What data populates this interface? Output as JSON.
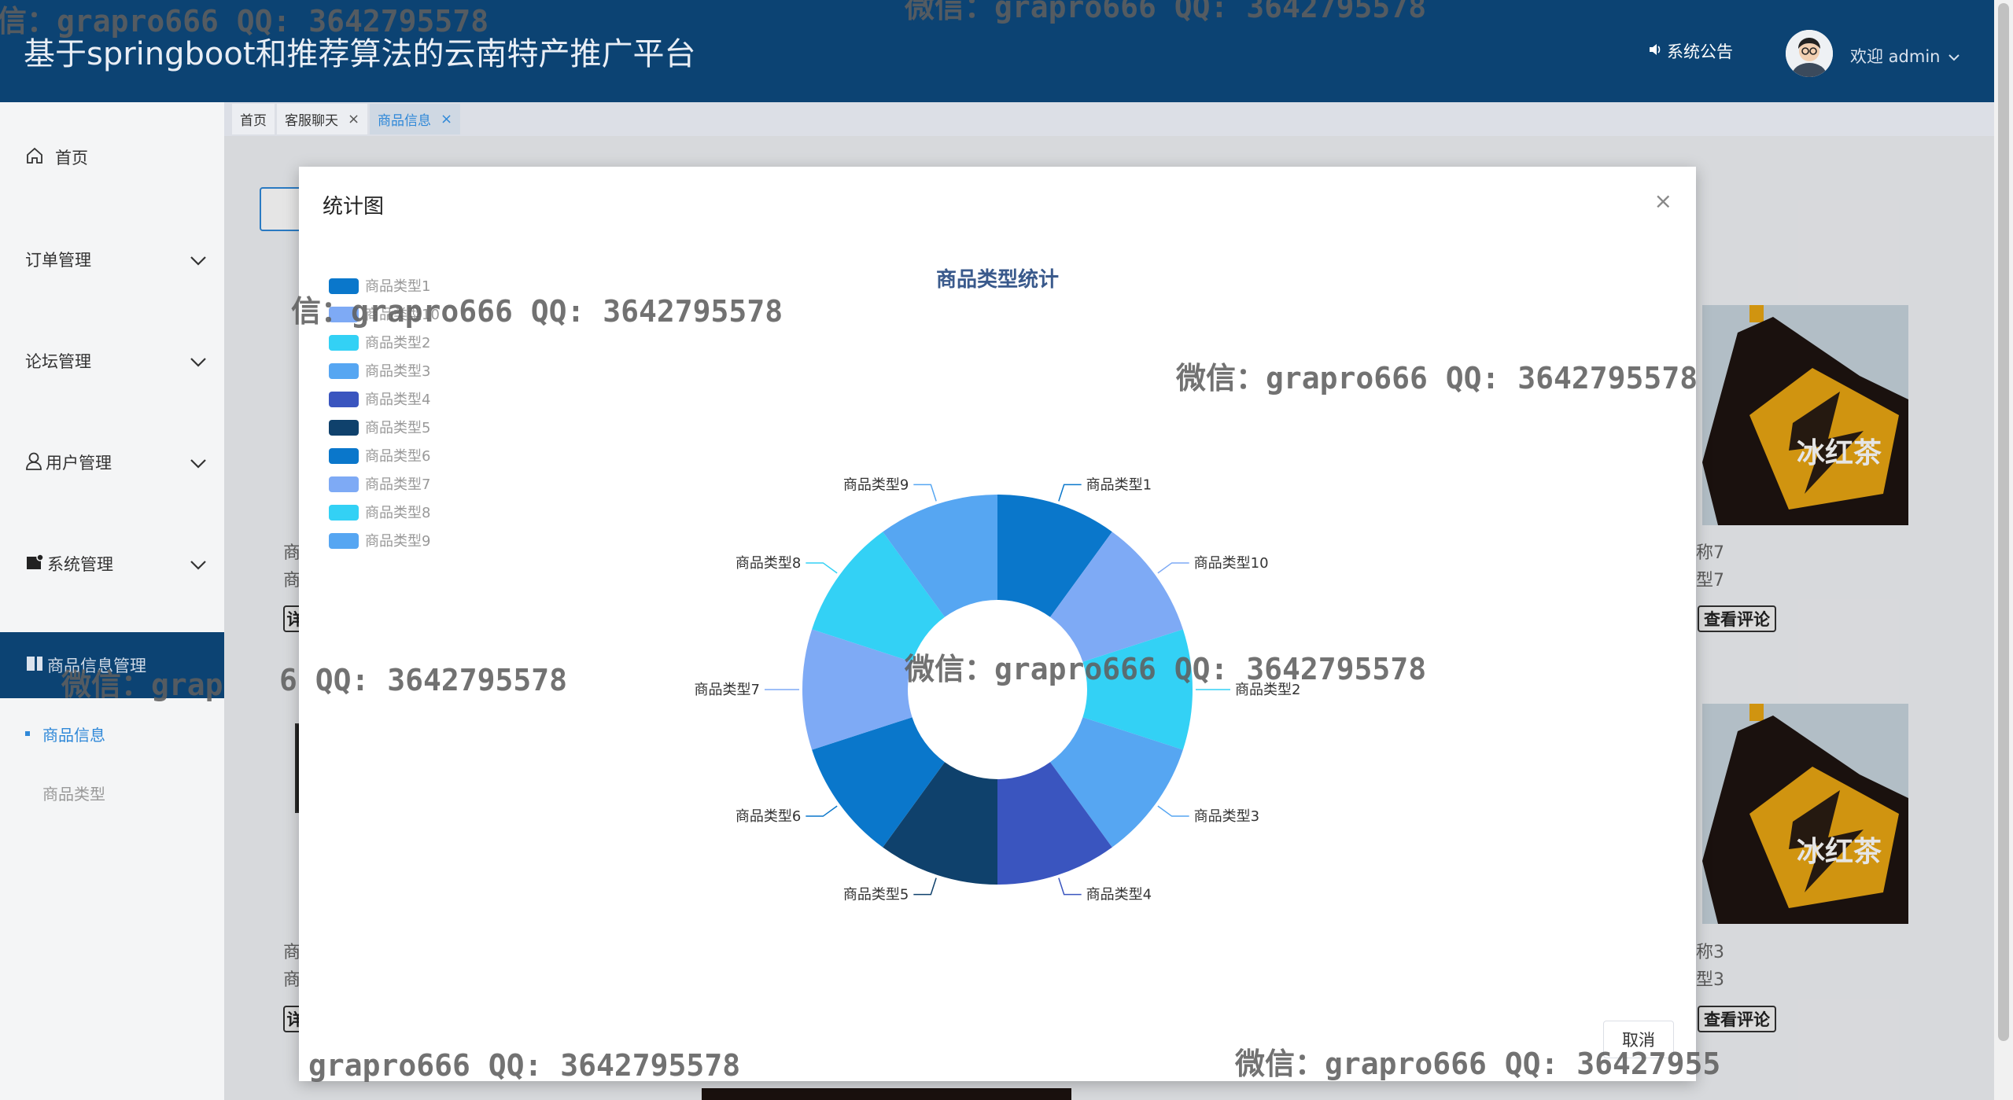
{
  "header": {
    "title": "基于springboot和推荐算法的云南特产推广平台",
    "announcement": "系统公告",
    "welcome": "欢迎 admin"
  },
  "tabs": [
    {
      "label": "首页"
    },
    {
      "label": "客服聊天",
      "close": "×"
    },
    {
      "label": "商品信息",
      "close": "×"
    }
  ],
  "sidebar": {
    "items": [
      {
        "label": "首页"
      },
      {
        "label": "订单管理"
      },
      {
        "label": "论坛管理"
      },
      {
        "label": "用户管理"
      },
      {
        "label": "系统管理"
      },
      {
        "label": "商品信息管理"
      }
    ],
    "sub_items": [
      {
        "label": "商品信息"
      },
      {
        "label": "商品类型"
      }
    ]
  },
  "background": {
    "text_right_1": "称7",
    "text_right_2": "型7",
    "text_right_3": "称3",
    "text_right_4": "型3",
    "text_left_1": "商",
    "text_left_2": "商",
    "text_left_3": "商",
    "text_left_4": "商",
    "comment_button": "查看评论",
    "left_btn_char": "详"
  },
  "modal": {
    "title": "统计图",
    "close": "×",
    "cancel": "取消"
  },
  "chart_data": {
    "type": "pie",
    "title": "商品类型统计",
    "donut": true,
    "legend_position": "top-left",
    "legend": [
      "商品类型1",
      "商品类型10",
      "商品类型2",
      "商品类型3",
      "商品类型4",
      "商品类型5",
      "商品类型6",
      "商品类型7",
      "商品类型8",
      "商品类型9"
    ],
    "categories": [
      "商品类型1",
      "商品类型10",
      "商品类型2",
      "商品类型3",
      "商品类型4",
      "商品类型5",
      "商品类型6",
      "商品类型7",
      "商品类型8",
      "商品类型9"
    ],
    "values": [
      1,
      1,
      1,
      1,
      1,
      1,
      1,
      1,
      1,
      1
    ],
    "colors": [
      "#0a77cb",
      "#7eaaf5",
      "#33d1f5",
      "#56a6f2",
      "#3a55bf",
      "#0f416c",
      "#0a77cb",
      "#7eaaf5",
      "#33d1f5",
      "#56a6f2"
    ]
  },
  "watermarks": [
    "信：grapro666 QQ: 3642795578",
    "微信：grapro666 QQ: 3642795578",
    "信：grapro666 QQ: 3642795578",
    "微信：grapro666 QQ: 3642795578",
    "6 QQ: 3642795578",
    "微信：grapro666 QQ: 3642795578",
    "微信：grap",
    "grapro666 QQ: 3642795578",
    "微信：grapro666 QQ: 36427955"
  ]
}
